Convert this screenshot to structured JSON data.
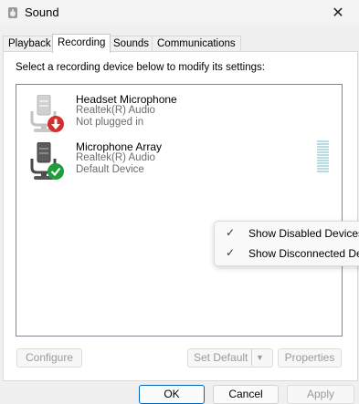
{
  "window": {
    "title": "Sound"
  },
  "tabs": [
    {
      "label": "Playback"
    },
    {
      "label": "Recording"
    },
    {
      "label": "Sounds"
    },
    {
      "label": "Communications"
    }
  ],
  "panel": {
    "instruction": "Select a recording device below to modify its settings:",
    "devices": [
      {
        "name": "Headset Microphone",
        "driver": "Realtek(R) Audio",
        "status": "Not plugged in",
        "icon": "microphone-unplugged-icon",
        "badge_color": "#d32f2f"
      },
      {
        "name": "Microphone Array",
        "driver": "Realtek(R) Audio",
        "status": "Default Device",
        "icon": "microphone-default-icon",
        "badge_color": "#1f9d3a"
      }
    ]
  },
  "context_menu": {
    "items": [
      {
        "label": "Show Disabled Devices",
        "checked": true
      },
      {
        "label": "Show Disconnected De",
        "checked": true
      }
    ]
  },
  "buttons": {
    "configure": "Configure",
    "set_default": "Set Default",
    "properties": "Properties",
    "ok": "OK",
    "cancel": "Cancel",
    "apply": "Apply"
  },
  "colors": {
    "accent": "#0067c0",
    "success": "#1f9d3a",
    "error": "#d32f2f"
  }
}
